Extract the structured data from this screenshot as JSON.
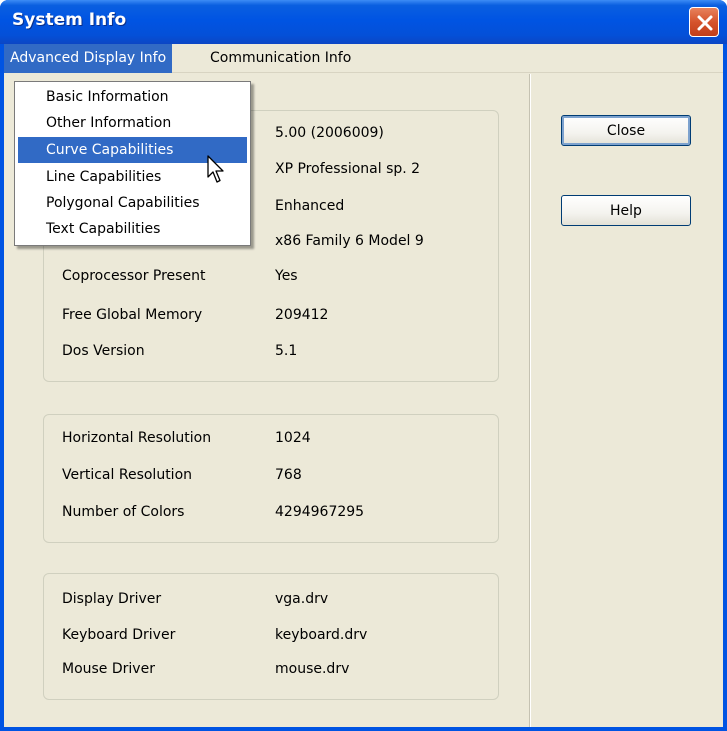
{
  "window": {
    "title": "System Info",
    "close_icon": "close-x-icon",
    "title_color": "#0054e3",
    "close_color": "#d5532c"
  },
  "menubar": {
    "items": [
      {
        "label": "Advanced Display Info",
        "open": true
      },
      {
        "label": "Communication Info",
        "open": false
      }
    ]
  },
  "dropdown": {
    "items": [
      {
        "label": "Basic Information",
        "highlighted": false
      },
      {
        "label": "Other Information",
        "highlighted": false
      },
      {
        "label": "Curve Capabilities",
        "highlighted": true
      },
      {
        "label": "Line Capabilities",
        "highlighted": false
      },
      {
        "label": "Polygonal Capabilities",
        "highlighted": false
      },
      {
        "label": "Text Capabilities",
        "highlighted": false
      }
    ],
    "highlight_color": "#316ac5"
  },
  "groups": {
    "system": {
      "rows": [
        {
          "label": "",
          "value": "5.00 (2006009)"
        },
        {
          "label": "",
          "value": "XP Professional sp. 2"
        },
        {
          "label": "",
          "value": "Enhanced"
        },
        {
          "label": "",
          "value": "x86 Family 6 Model 9"
        },
        {
          "label": "Coprocessor Present",
          "value": "Yes"
        },
        {
          "label": "Free Global Memory",
          "value": "209412"
        },
        {
          "label": "Dos Version",
          "value": "5.1"
        }
      ]
    },
    "display": {
      "rows": [
        {
          "label": "Horizontal Resolution",
          "value": "1024"
        },
        {
          "label": "Vertical Resolution",
          "value": "768"
        },
        {
          "label": "Number of Colors",
          "value": "4294967295"
        }
      ]
    },
    "drivers": {
      "rows": [
        {
          "label": "Display Driver",
          "value": "vga.drv"
        },
        {
          "label": "Keyboard Driver",
          "value": "keyboard.drv"
        },
        {
          "label": "Mouse Driver",
          "value": "mouse.drv"
        }
      ]
    }
  },
  "buttons": {
    "close_label": "Close",
    "help_label": "Help"
  }
}
